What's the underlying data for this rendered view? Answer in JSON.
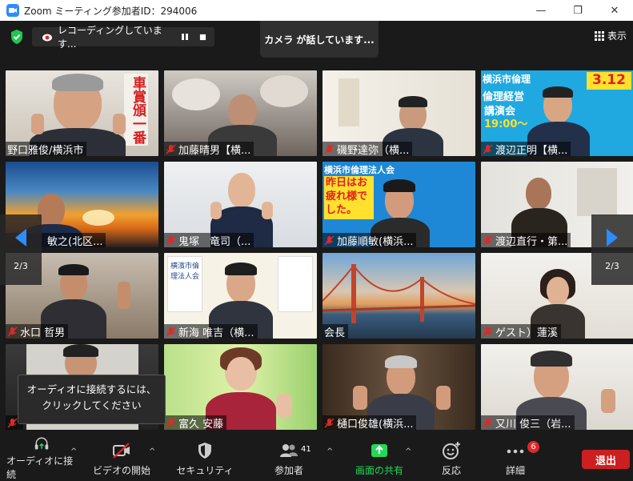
{
  "window": {
    "title": "Zoom ミーティング参加者ID：294006",
    "minimize": "—",
    "maximize": "❐",
    "close": "✕"
  },
  "topbar": {
    "recording_label": "レコーディングしています...",
    "talking_label": "カメラ が話しています...",
    "view_label": "表示"
  },
  "navigation": {
    "left_page": "2/3",
    "right_page": "2/3"
  },
  "participants": [
    {
      "name": "野口雅俊/横浜市",
      "muted": false
    },
    {
      "name": "加藤晴男【横...",
      "muted": true
    },
    {
      "name": "磯野達弥（横...",
      "muted": true
    },
    {
      "name": "渡辺正明【横...",
      "muted": true
    },
    {
      "name": "敏之(北区...",
      "muted": false
    },
    {
      "name": "鬼塚　竜司（...",
      "muted": true
    },
    {
      "name": "加藤順敏(横浜...",
      "muted": true
    },
    {
      "name": "渡辺直行・第...",
      "muted": true
    },
    {
      "name": "水口 哲男",
      "muted": true
    },
    {
      "name": "新海 唯吉（横...",
      "muted": true
    },
    {
      "name": "会長",
      "muted": false
    },
    {
      "name": "ゲスト）蓮溪",
      "muted": true
    },
    {
      "name": "",
      "muted": true
    },
    {
      "name": "富久 安藤",
      "muted": true
    },
    {
      "name": "樋口俊雄(横浜...",
      "muted": true
    },
    {
      "name": "又川 俊三（岩...",
      "muted": true
    }
  ],
  "tile_text": {
    "t1_banner": "車賞頒一番",
    "t4_date": "3.12",
    "t4_line1": "倫理経営",
    "t4_line2": "講演会",
    "t4_line3": "19:00～",
    "t4_header": "横浜市倫理",
    "t7_header": "横浜市倫理法人会",
    "t7_line1": "昨日はお",
    "t7_line2": "疲れ様で",
    "t7_line3": "した。",
    "t10_poster": "横濱市倫理法人会"
  },
  "tooltip": {
    "text": "オーディオに接続するには、クリックしてください"
  },
  "toolbar": {
    "audio": "オーディオに接続",
    "video": "ビデオの開始",
    "security": "セキュリティ",
    "participants": "参加者",
    "participants_count": "41",
    "share": "画面の共有",
    "reactions": "反応",
    "more": "詳細",
    "more_badge": "6",
    "leave": "退出"
  },
  "colors": {
    "accent_blue": "#2d8cff",
    "share_green": "#23d959",
    "leave_red": "#cc1f1f",
    "mute_red": "#e02828"
  }
}
